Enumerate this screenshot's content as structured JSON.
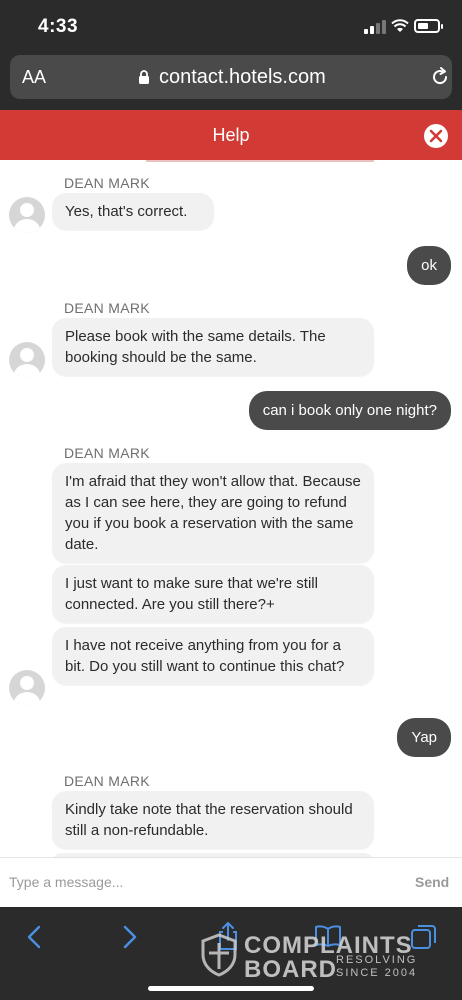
{
  "status_bar": {
    "time": "4:33"
  },
  "browser": {
    "text_size_label": "AA",
    "url": "contact.hotels.com"
  },
  "help": {
    "title": "Help"
  },
  "agent": {
    "name": "DEAN MARK"
  },
  "messages": {
    "m1": "Yes, that's correct.",
    "m2": "ok",
    "m3": "Please book with the same details. The booking should be the same.",
    "m4": "can i book only one night?",
    "m5": "I'm afraid that they won't allow that. Because as I can see here, they are going to refund you if you book a reservation with the same date.",
    "m6": "I just want to make sure that we're still connected. Are you still there?+",
    "m7": "I have not receive anything from you for a bit. Do you still want to continue this chat?",
    "m8": "Yap",
    "m9": "Kindly take note that the reservation should still a non-refundable."
  },
  "composer": {
    "placeholder": "Type a message...",
    "send_label": "Send"
  },
  "watermark": {
    "line1": "COMPLAINTS",
    "line2": "BOARD",
    "tag1": "RESOLVING",
    "tag2": "SINCE 2004"
  },
  "colors": {
    "accent": "#d23a35",
    "outgoing_bubble": "#4a4a4a",
    "incoming_bubble": "#f1f1f1"
  }
}
